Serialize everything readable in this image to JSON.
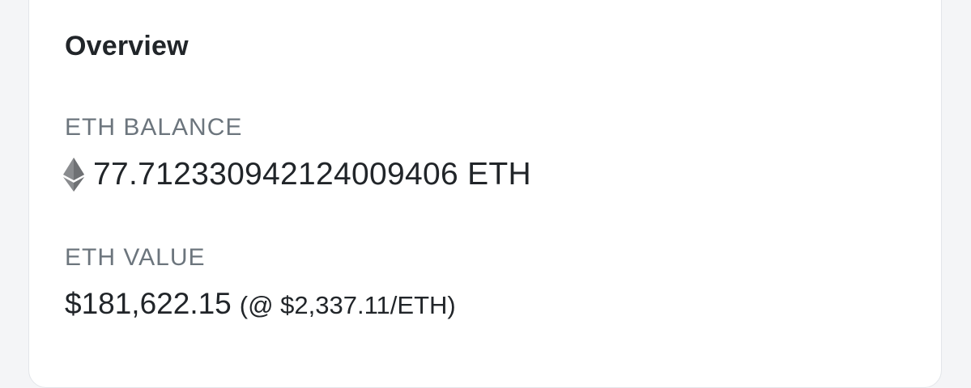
{
  "overview": {
    "title": "Overview",
    "balance_label": "ETH BALANCE",
    "balance_icon": "ethereum-icon",
    "balance_value": "77.712330942124009406 ETH",
    "value_label": "ETH VALUE",
    "value_amount": "$181,622.15",
    "value_price": "(@ $2,337.11/ETH)"
  },
  "colors": {
    "text_primary": "#212529",
    "text_muted": "#6c757d",
    "card_background": "#ffffff",
    "page_background": "#f4f5f7",
    "eth_icon": "#7d7f82"
  }
}
